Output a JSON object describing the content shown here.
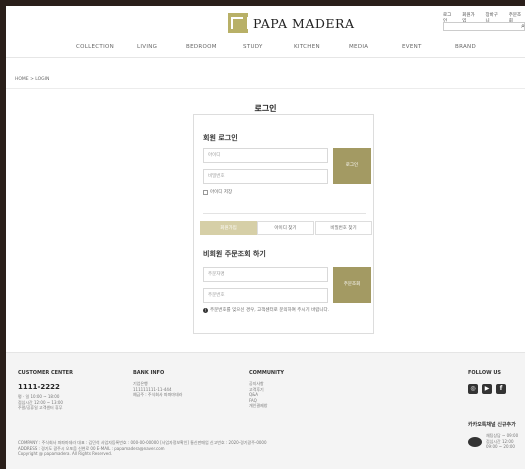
{
  "header": {
    "logo_text": "PAPA MADERA",
    "util_links": [
      "로그인",
      "회원가입",
      "장바구니",
      "주문조회"
    ],
    "nav": [
      "COLLECTION",
      "LIVING",
      "BEDROOM",
      "STUDY",
      "KITCHEN",
      "MEDIA",
      "EVENT",
      "BRAND"
    ]
  },
  "breadcrumb": "HOME > LOGIN",
  "page_title": "로그인",
  "member_login": {
    "title": "회원 로그인",
    "id_placeholder": "아이디",
    "pw_placeholder": "비밀번호",
    "login_button": "로그인",
    "save_id_label": "아이디 저장"
  },
  "tabs": [
    "회원가입",
    "아이디 찾기",
    "비밀번호 찾기"
  ],
  "guest": {
    "title": "비회원 주문조회 하기",
    "name_placeholder": "주문자명",
    "order_placeholder": "주문번호",
    "lookup_button": "주문조회",
    "notice": "주문번호를 잊으신 경우, 고객센터로 문의하여 주시기 바랍니다."
  },
  "footer": {
    "customer_center_title": "CUSTOMER CENTER",
    "phone": "1111-2222",
    "hours": [
      "평 · 일 10:00 ~ 18:00",
      "점심시간 12:00 ~ 13:00",
      "주말/공휴일 고객센터 휴무"
    ],
    "bank_title": "BANK INFO",
    "bank_lines": [
      "기업은행",
      "111111111-11-444",
      "예금주 : 주식회사 파파마데라"
    ],
    "community_title": "COMMUNITY",
    "community_links": [
      "공지사항",
      "고객후기",
      "Q&A",
      "FAQ",
      "개인결제창"
    ],
    "follow_title": "FOLLOW US",
    "sns": [
      "instagram-icon",
      "youtube-icon",
      "facebook-icon"
    ],
    "kakao_title": "카카오톡채널 신규추가",
    "kakao_lines": [
      "채팅상담 ~ 09:00",
      "점심시간 12:00",
      "09:00 ~ 20:00"
    ],
    "company_line1": "COMPANY : 주식회사 파파마데라    대표 : 김민석    사업자등록번호 : 000-00-00000 [사업자정보확인]    통신판매업 신고번호 : 2020-경기광주-0000",
    "company_line2": "ADDRESS : 경기도 광주시 오포읍 신현로 00    E-MAIL : papamadera@naver.com",
    "copyright": "Copyright @ papamadera. All Rights Reserved."
  },
  "colors": {
    "accent": "#a39a63",
    "tab_active": "#d6cfa7"
  }
}
